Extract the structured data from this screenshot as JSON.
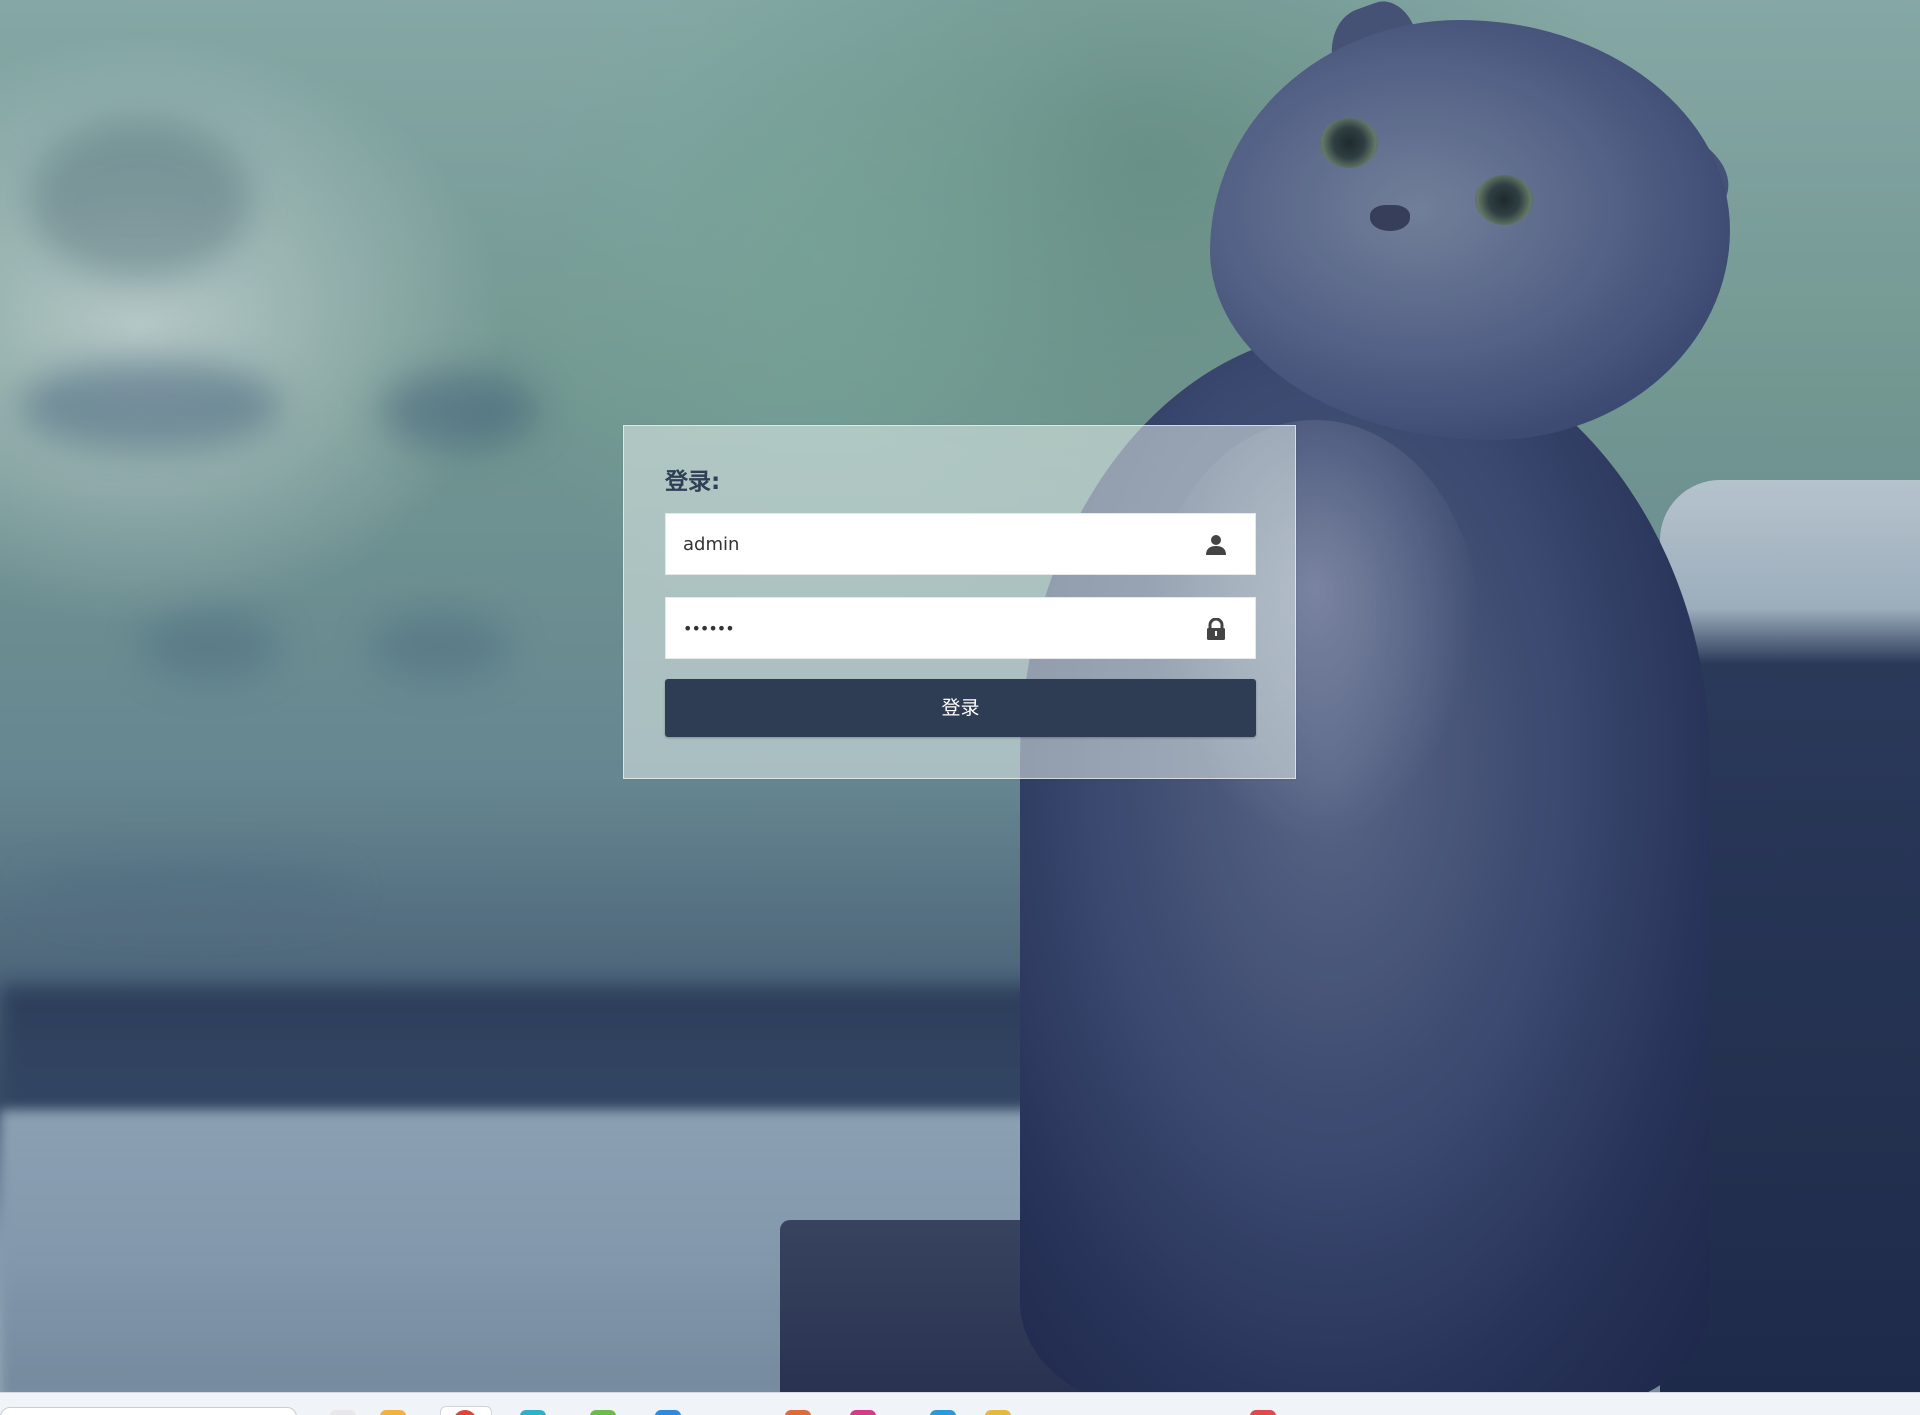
{
  "login": {
    "title": "登录:",
    "username": {
      "value": "admin",
      "icon": "user-icon"
    },
    "password": {
      "value": "••••••",
      "icon": "lock-icon"
    },
    "submit_label": "登录"
  },
  "colors": {
    "button_bg": "#2e3d53",
    "title_text": "#2f3f55",
    "panel_bg": "rgba(226,236,234,0.55)"
  },
  "background": {
    "subject": "cat-photo"
  },
  "taskbar": {
    "icons": [
      "app-icon-1",
      "app-icon-2",
      "chrome-icon",
      "app-icon-4",
      "app-icon-5",
      "app-icon-6",
      "app-icon-7",
      "app-icon-8",
      "app-icon-9",
      "app-icon-10",
      "app-icon-11"
    ]
  }
}
